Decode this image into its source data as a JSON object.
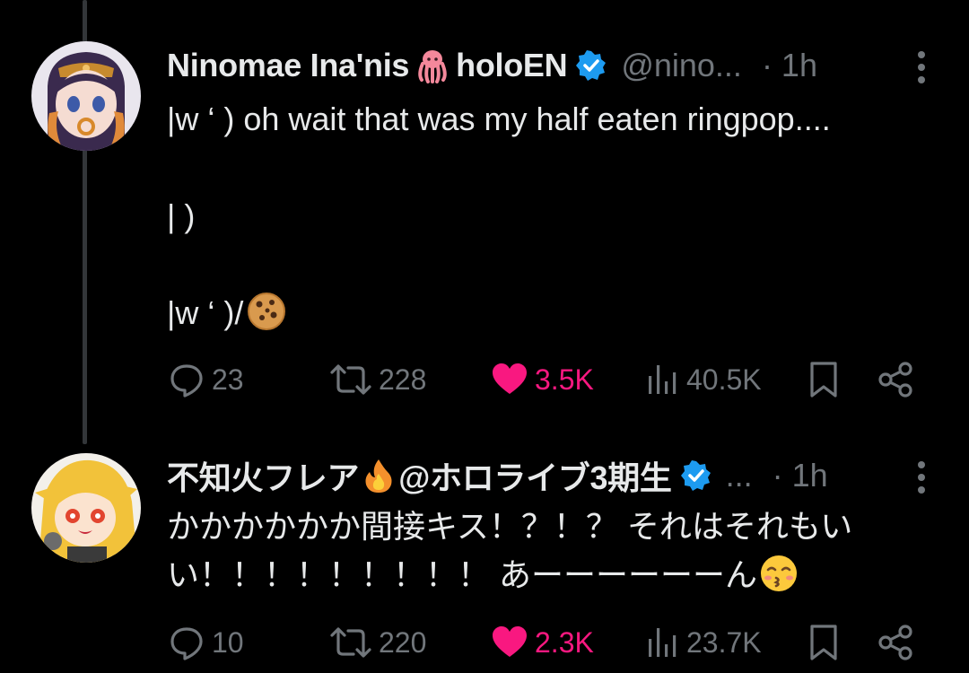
{
  "tweets": [
    {
      "name": "Ninomae Ina'nis",
      "name_suffix": "holoEN",
      "handle": "@nino...",
      "time": "· 1h",
      "body": "|w ‘ ) oh wait that was my half eaten ringpop....\n\n| )\n\n|w ‘ )/",
      "body_emoji": "cookie-emoji",
      "actions": {
        "replies": "23",
        "reposts": "228",
        "likes": "3.5K",
        "views": "40.5K"
      },
      "liked": true
    },
    {
      "name": "不知火フレア",
      "name_suffix": "@ホロライブ3期生",
      "handle": "...",
      "time": "· 1h",
      "body": "かかかかかか間接キス！？！？ それはそれもいい！！！！！！！！！ あーーーーーーん",
      "body_emoji": "kissing-face-emoji",
      "actions": {
        "replies": "10",
        "reposts": "220",
        "likes": "2.3K",
        "views": "23.7K"
      },
      "liked": true
    }
  ],
  "colors": {
    "background": "#000000",
    "text": "#e7e9ea",
    "muted": "#71767b",
    "like": "#f91880",
    "verified": "#1d9bf0",
    "thread_line": "#333639"
  }
}
